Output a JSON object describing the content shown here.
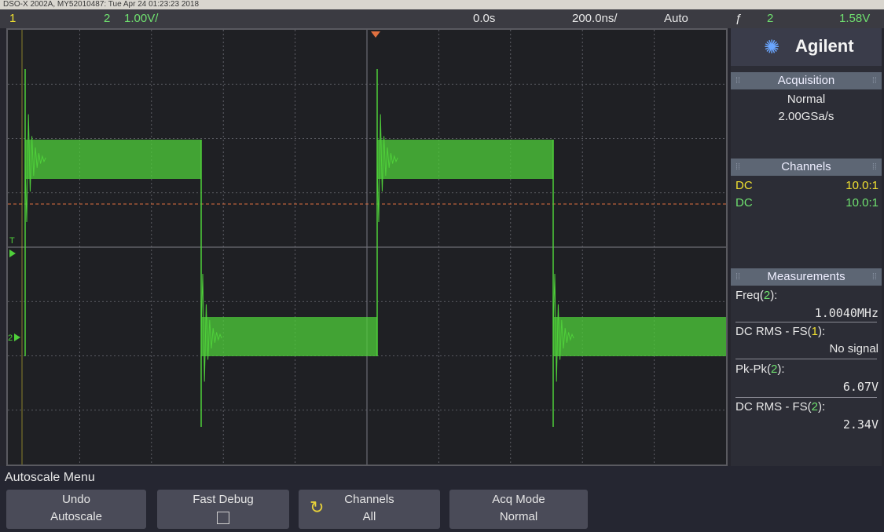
{
  "top_caption": "DSO-X 2002A, MY52010487: Tue Apr 24 01:23:23 2018",
  "status": {
    "ch1_number": "1",
    "ch2_number": "2",
    "ch2_scale": "1.00V/",
    "time_delay": "0.0s",
    "time_scale": "200.0ns/",
    "trigger_mode": "Auto",
    "trigger_edge_symbol": "ƒ",
    "trigger_source": "2",
    "trigger_level": "1.58V"
  },
  "display": {
    "trigger_marker": "T",
    "ch2_marker": "2",
    "colors": {
      "ch1": "#f0e030",
      "ch2": "#4fcf3a",
      "trigger_level_line": "#e07040",
      "grid": "#6c6c74"
    }
  },
  "panel": {
    "brand": "Agilent",
    "brand_icon": "agilent-spark-icon",
    "acquisition": {
      "title": "Acquisition",
      "mode": "Normal",
      "rate": "2.00GSa/s"
    },
    "channels": {
      "title": "Channels",
      "rows": [
        {
          "coupling": "DC",
          "probe": "10.0:1"
        },
        {
          "coupling": "DC",
          "probe": "10.0:1"
        }
      ]
    },
    "measurements": {
      "title": "Measurements",
      "items": [
        {
          "label": "Freq(",
          "src": "2",
          "close": "):",
          "value": "1.0040MHz"
        },
        {
          "label": "DC RMS - FS(",
          "src": "1",
          "close": "):",
          "value": "No signal"
        },
        {
          "label": "Pk-Pk(",
          "src": "2",
          "close": "):",
          "value": "6.07V"
        },
        {
          "label": "DC RMS - FS(",
          "src": "2",
          "close": "):",
          "value": "2.34V"
        }
      ]
    }
  },
  "menu": {
    "title": "Autoscale Menu",
    "softkeys": [
      {
        "line1": "Undo",
        "line2": "Autoscale"
      },
      {
        "line1": "Fast Debug",
        "line2": ""
      },
      {
        "line1": "Channels",
        "line2": "All"
      },
      {
        "line1": "Acq Mode",
        "line2": "Normal"
      }
    ]
  }
}
